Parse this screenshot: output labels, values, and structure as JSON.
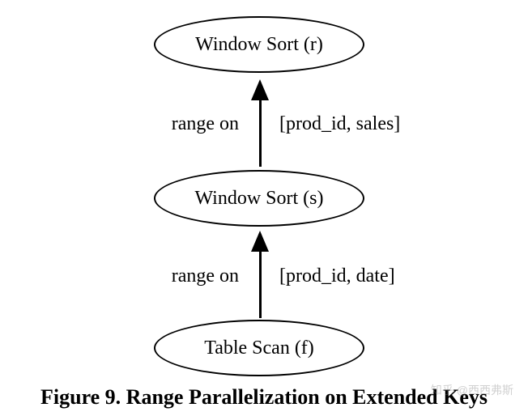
{
  "nodes": {
    "top": "Window Sort (r)",
    "middle": "Window Sort (s)",
    "bottom": "Table Scan (f)"
  },
  "edges": {
    "top": {
      "left_label": "range  on",
      "right_label": "[prod_id, sales]"
    },
    "bottom": {
      "left_label": "range on",
      "right_label": "[prod_id, date]"
    }
  },
  "caption": "Figure 9. Range Parallelization on Extended Keys",
  "watermark": "知乎 @西西弗斯"
}
